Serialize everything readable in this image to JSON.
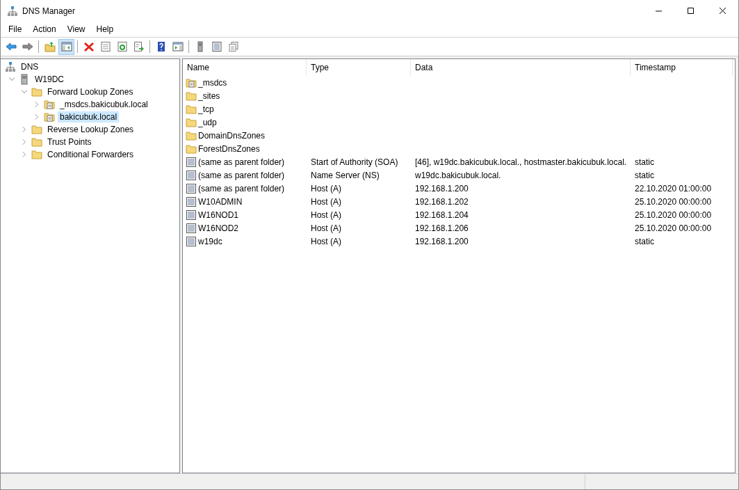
{
  "window": {
    "title": "DNS Manager"
  },
  "menu": [
    "File",
    "Action",
    "View",
    "Help"
  ],
  "toolbar": [
    {
      "kind": "back",
      "selected": false
    },
    {
      "kind": "forward",
      "selected": false
    },
    {
      "kind": "separator"
    },
    {
      "kind": "up",
      "selected": false
    },
    {
      "kind": "tree",
      "selected": true
    },
    {
      "kind": "separator"
    },
    {
      "kind": "delete",
      "selected": false
    },
    {
      "kind": "properties",
      "selected": false
    },
    {
      "kind": "refresh",
      "selected": false
    },
    {
      "kind": "export",
      "selected": false
    },
    {
      "kind": "separator"
    },
    {
      "kind": "help",
      "selected": false
    },
    {
      "kind": "pane",
      "selected": false
    },
    {
      "kind": "separator"
    },
    {
      "kind": "server",
      "selected": false
    },
    {
      "kind": "list",
      "selected": false
    },
    {
      "kind": "copy",
      "selected": false
    }
  ],
  "tree": [
    {
      "label": "DNS",
      "kind": "dns",
      "selected": false,
      "children": [
        {
          "label": "W19DC",
          "kind": "server",
          "expanded": true,
          "selected": false,
          "children": [
            {
              "label": "Forward Lookup Zones",
              "kind": "folder",
              "expanded": true,
              "selected": false,
              "children": [
                {
                  "label": "_msdcs.bakicubuk.local",
                  "kind": "zone",
                  "expanded": false,
                  "selected": false
                },
                {
                  "label": "bakicubuk.local",
                  "kind": "zone",
                  "expanded": false,
                  "selected": true
                }
              ]
            },
            {
              "label": "Reverse Lookup Zones",
              "kind": "folder",
              "expanded": false,
              "selected": false
            },
            {
              "label": "Trust Points",
              "kind": "folder",
              "expanded": false,
              "selected": false
            },
            {
              "label": "Conditional Forwarders",
              "kind": "folder",
              "expanded": false,
              "selected": false
            }
          ]
        }
      ]
    }
  ],
  "table": {
    "columns": [
      "Name",
      "Type",
      "Data",
      "Timestamp"
    ],
    "rows": [
      {
        "kind": "zone",
        "cells": [
          "_msdcs",
          "",
          "",
          ""
        ]
      },
      {
        "kind": "folder",
        "cells": [
          "_sites",
          "",
          "",
          ""
        ]
      },
      {
        "kind": "folder",
        "cells": [
          "_tcp",
          "",
          "",
          ""
        ]
      },
      {
        "kind": "folder",
        "cells": [
          "_udp",
          "",
          "",
          ""
        ]
      },
      {
        "kind": "folder",
        "cells": [
          "DomainDnsZones",
          "",
          "",
          ""
        ]
      },
      {
        "kind": "folder",
        "cells": [
          "ForestDnsZones",
          "",
          "",
          ""
        ]
      },
      {
        "kind": "record",
        "cells": [
          "(same as parent folder)",
          "Start of Authority (SOA)",
          "[46], w19dc.bakicubuk.local., hostmaster.bakicubuk.local.",
          "static"
        ]
      },
      {
        "kind": "record",
        "cells": [
          "(same as parent folder)",
          "Name Server (NS)",
          "w19dc.bakicubuk.local.",
          "static"
        ]
      },
      {
        "kind": "record",
        "cells": [
          "(same as parent folder)",
          "Host (A)",
          "192.168.1.200",
          "22.10.2020 01:00:00"
        ]
      },
      {
        "kind": "record",
        "cells": [
          "W10ADMIN",
          "Host (A)",
          "192.168.1.202",
          "25.10.2020 00:00:00"
        ]
      },
      {
        "kind": "record",
        "cells": [
          "W16NOD1",
          "Host (A)",
          "192.168.1.204",
          "25.10.2020 00:00:00"
        ]
      },
      {
        "kind": "record",
        "cells": [
          "W16NOD2",
          "Host (A)",
          "192.168.1.206",
          "25.10.2020 00:00:00"
        ]
      },
      {
        "kind": "record",
        "cells": [
          "w19dc",
          "Host (A)",
          "192.168.1.200",
          "static"
        ]
      }
    ]
  }
}
